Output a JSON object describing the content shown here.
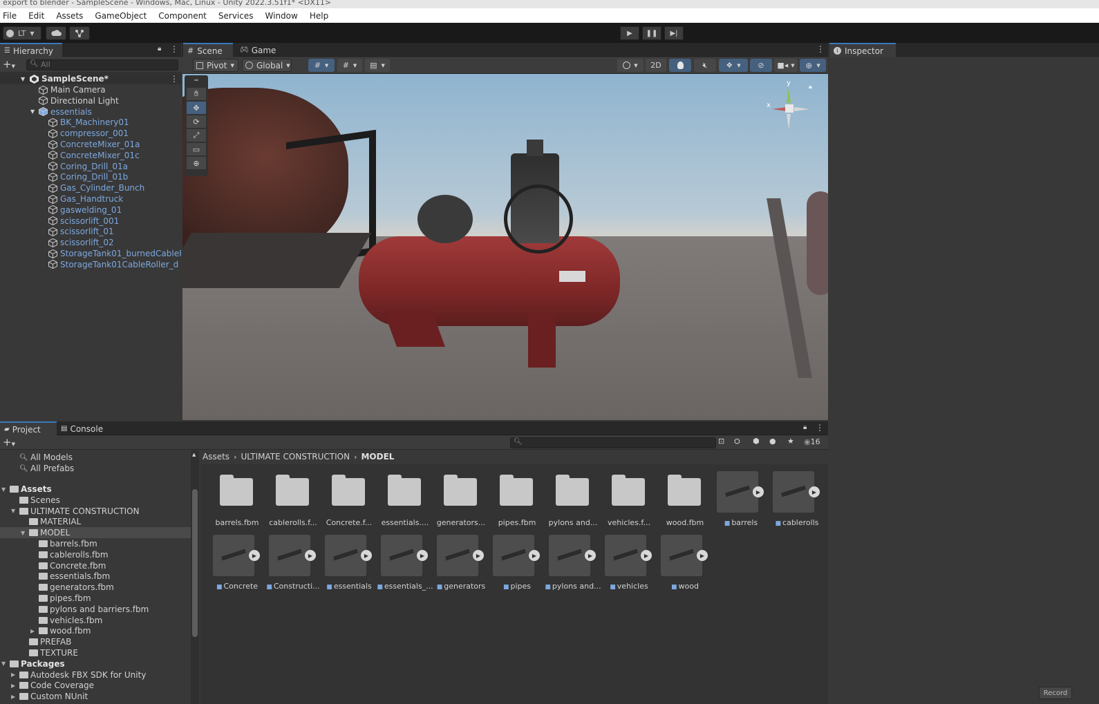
{
  "window": {
    "title": "export to blender - SampleScene - Windows, Mac, Linux - Unity 2022.3.51f1* <DX11>"
  },
  "menu": [
    "File",
    "Edit",
    "Assets",
    "GameObject",
    "Component",
    "Services",
    "Window",
    "Help"
  ],
  "toolbar": {
    "account": "LT"
  },
  "hierarchy": {
    "tab": "Hierarchy",
    "search_placeholder": "All",
    "scene": "SampleScene*",
    "items": [
      {
        "label": "Main Camera",
        "depth": 1,
        "blue": false
      },
      {
        "label": "Directional Light",
        "depth": 1,
        "blue": false
      },
      {
        "label": "essentials",
        "depth": 1,
        "blue": true,
        "expanded": true
      },
      {
        "label": "BK_Machinery01",
        "depth": 2,
        "blue": true
      },
      {
        "label": "compressor_001",
        "depth": 2,
        "blue": true
      },
      {
        "label": "ConcreteMixer_01a",
        "depth": 2,
        "blue": true
      },
      {
        "label": "ConcreteMixer_01c",
        "depth": 2,
        "blue": true
      },
      {
        "label": "Coring_Drill_01a",
        "depth": 2,
        "blue": true
      },
      {
        "label": "Coring_Drill_01b",
        "depth": 2,
        "blue": true
      },
      {
        "label": "Gas_Cylinder_Bunch",
        "depth": 2,
        "blue": true
      },
      {
        "label": "Gas_Handtruck",
        "depth": 2,
        "blue": true
      },
      {
        "label": "gaswelding_01",
        "depth": 2,
        "blue": true
      },
      {
        "label": "scissorlift_001",
        "depth": 2,
        "blue": true
      },
      {
        "label": "scissorlift_01",
        "depth": 2,
        "blue": true
      },
      {
        "label": "scissorlift_02",
        "depth": 2,
        "blue": true
      },
      {
        "label": "StorageTank01_burnedCableRo",
        "depth": 2,
        "blue": true
      },
      {
        "label": "StorageTank01CableRoller_d",
        "depth": 2,
        "blue": true
      }
    ]
  },
  "scene_view": {
    "tabs": [
      "Scene",
      "Game"
    ],
    "pivot": "Pivot",
    "global": "Global",
    "mode_2d": "2D",
    "gizmo_y": "y",
    "gizmo_x": "x"
  },
  "inspector": {
    "tab": "Inspector"
  },
  "project": {
    "tabs": [
      "Project",
      "Console"
    ],
    "visible_count": "16",
    "favorites": [
      "All Models",
      "All Prefabs"
    ],
    "tree": [
      {
        "label": "Assets",
        "depth": 0,
        "bold": true,
        "arrow": "down"
      },
      {
        "label": "Scenes",
        "depth": 1
      },
      {
        "label": "ULTIMATE CONSTRUCTION",
        "depth": 1,
        "arrow": "down"
      },
      {
        "label": "MATERIAL",
        "depth": 2
      },
      {
        "label": "MODEL",
        "depth": 2,
        "arrow": "down",
        "selected": true
      },
      {
        "label": "barrels.fbm",
        "depth": 3
      },
      {
        "label": "cablerolls.fbm",
        "depth": 3
      },
      {
        "label": "Concrete.fbm",
        "depth": 3
      },
      {
        "label": "essentials.fbm",
        "depth": 3
      },
      {
        "label": "generators.fbm",
        "depth": 3
      },
      {
        "label": "pipes.fbm",
        "depth": 3
      },
      {
        "label": "pylons and barriers.fbm",
        "depth": 3
      },
      {
        "label": "vehicles.fbm",
        "depth": 3
      },
      {
        "label": "wood.fbm",
        "depth": 3,
        "arrow": "right"
      },
      {
        "label": "PREFAB",
        "depth": 2
      },
      {
        "label": "TEXTURE",
        "depth": 2
      },
      {
        "label": "Packages",
        "depth": 0,
        "bold": true,
        "arrow": "down"
      },
      {
        "label": "Autodesk FBX SDK for Unity",
        "depth": 1,
        "arrow": "right"
      },
      {
        "label": "Code Coverage",
        "depth": 1,
        "arrow": "right"
      },
      {
        "label": "Custom NUnit",
        "depth": 1,
        "arrow": "right"
      }
    ],
    "breadcrumb": [
      "Assets",
      "ULTIMATE CONSTRUCTION",
      "MODEL"
    ],
    "grid_row1": [
      {
        "label": "barrels.fbm",
        "kind": "folder"
      },
      {
        "label": "cablerolls.f...",
        "kind": "folder"
      },
      {
        "label": "Concrete.f...",
        "kind": "folder"
      },
      {
        "label": "essentials....",
        "kind": "folder"
      },
      {
        "label": "generators...",
        "kind": "folder"
      },
      {
        "label": "pipes.fbm",
        "kind": "folder"
      },
      {
        "label": "pylons and...",
        "kind": "folder"
      },
      {
        "label": "vehicles.f...",
        "kind": "folder"
      },
      {
        "label": "wood.fbm",
        "kind": "folder"
      },
      {
        "label": "barrels",
        "kind": "model"
      },
      {
        "label": "cablerolls",
        "kind": "model"
      }
    ],
    "grid_row2": [
      {
        "label": "Concrete",
        "kind": "model"
      },
      {
        "label": "Constructi...",
        "kind": "model"
      },
      {
        "label": "essentials",
        "kind": "model"
      },
      {
        "label": "essentials_...",
        "kind": "model"
      },
      {
        "label": "generators",
        "kind": "model"
      },
      {
        "label": "pipes",
        "kind": "model"
      },
      {
        "label": "pylons and...",
        "kind": "model"
      },
      {
        "label": "vehicles",
        "kind": "model"
      },
      {
        "label": "wood",
        "kind": "model"
      }
    ]
  },
  "status": {
    "record": "Record"
  },
  "colors": {
    "accent": "#3a79bb",
    "prefab_blue": "#7da8e0",
    "panel": "#383838",
    "tabstrip": "#282828"
  }
}
